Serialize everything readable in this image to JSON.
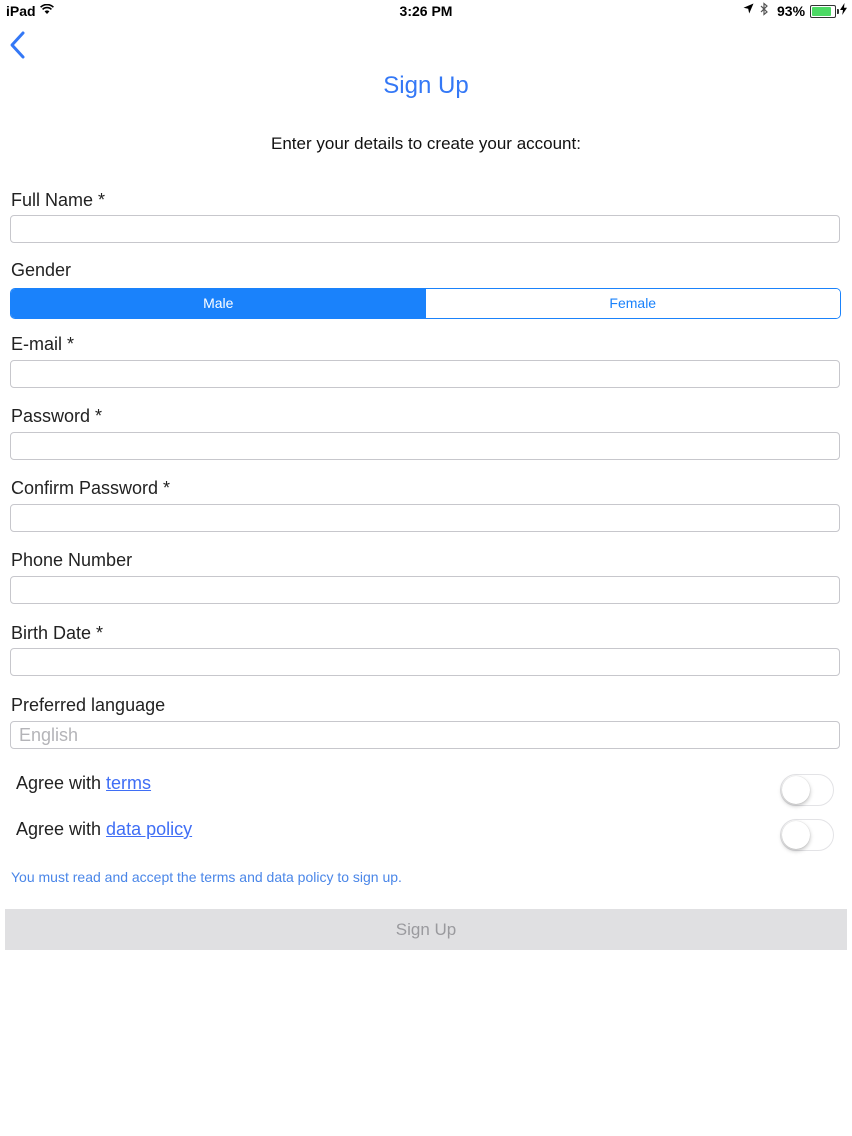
{
  "status_bar": {
    "device": "iPad",
    "time": "3:26 PM",
    "battery_percent": "93%",
    "battery_level": 0.93
  },
  "nav": {
    "back_icon": "chevron-left-icon",
    "title": "Sign Up"
  },
  "intro": "Enter your details to create your account:",
  "form": {
    "full_name": {
      "label": "Full Name *",
      "value": ""
    },
    "gender": {
      "label": "Gender",
      "options": [
        "Male",
        "Female"
      ],
      "selected": "Male"
    },
    "email": {
      "label": "E-mail *",
      "value": ""
    },
    "password": {
      "label": "Password *",
      "value": ""
    },
    "confirm_password": {
      "label": "Confirm Password *",
      "value": ""
    },
    "phone": {
      "label": "Phone Number",
      "value": ""
    },
    "birth_date": {
      "label": "Birth Date *",
      "value": ""
    },
    "language": {
      "label": "Preferred language",
      "placeholder": "English",
      "value": ""
    }
  },
  "agreements": {
    "terms": {
      "prefix": "Agree with ",
      "link": "terms",
      "on": false
    },
    "data_policy": {
      "prefix": "Agree with ",
      "link": "data policy",
      "on": false
    }
  },
  "note": "You must read and accept the terms and data policy to sign up.",
  "signup_button": "Sign Up",
  "colors": {
    "accent": "#1a82fb",
    "link": "#3f6ef5",
    "disabled_button": "#e0e0e2"
  }
}
